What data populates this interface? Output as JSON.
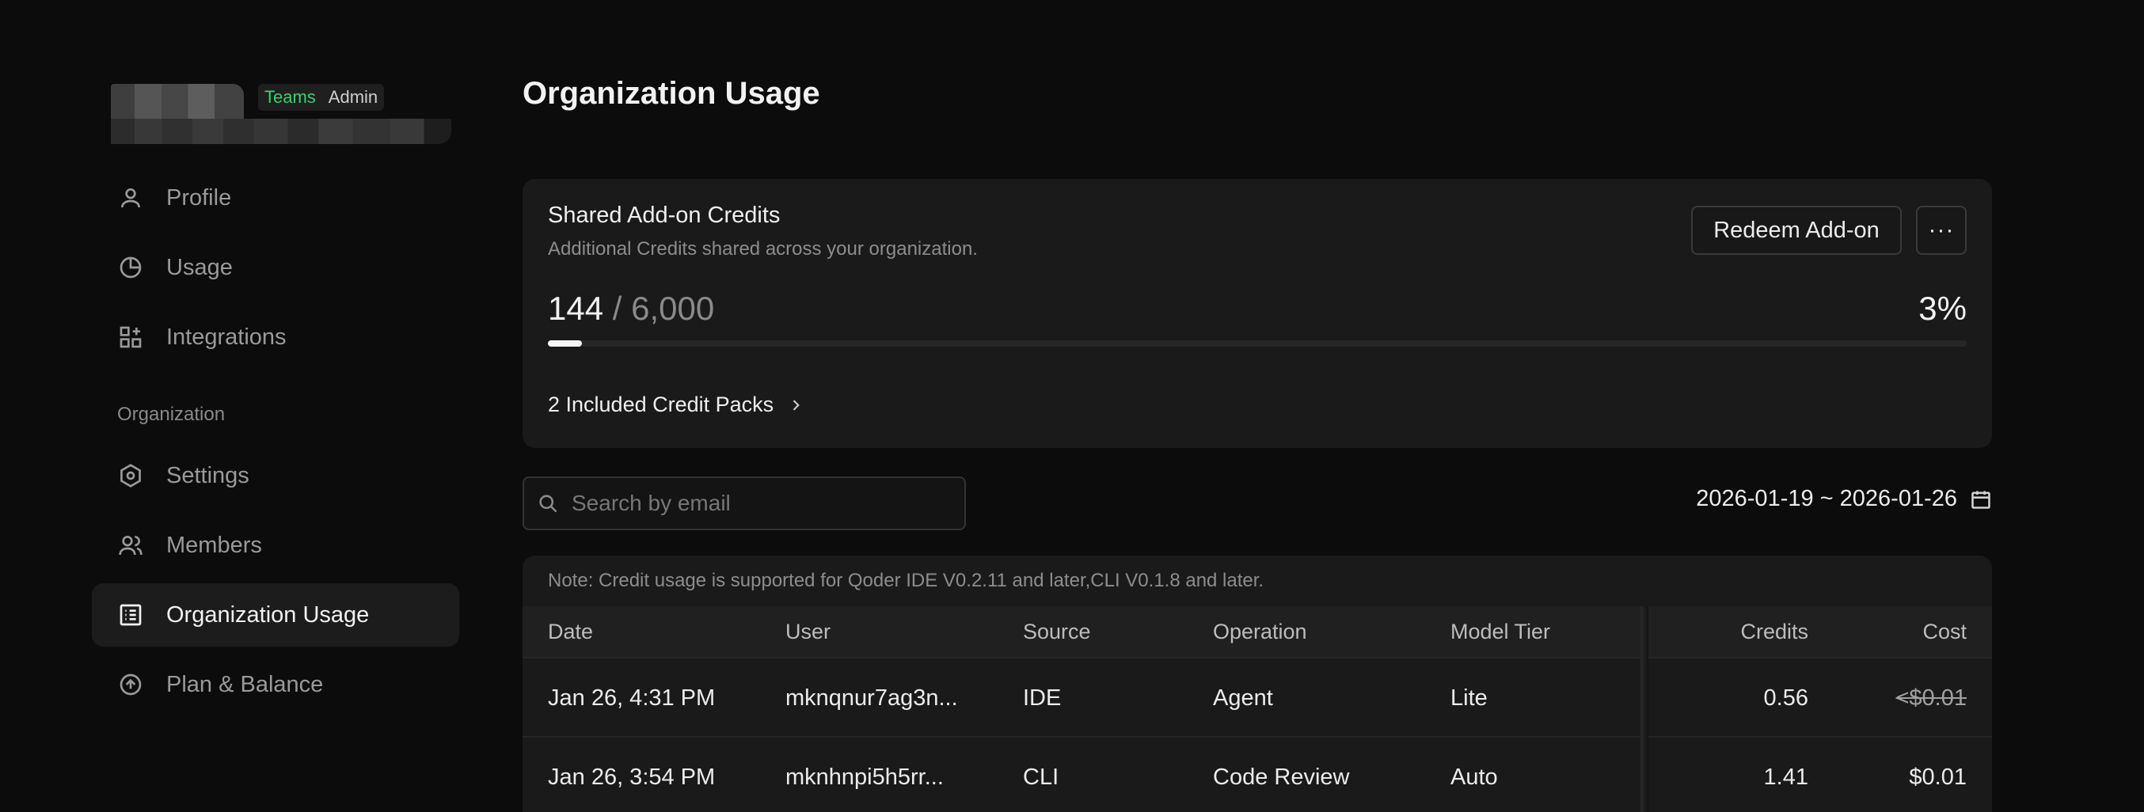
{
  "account": {
    "badge_plan": "Teams",
    "badge_role": "Admin"
  },
  "sidebar": {
    "items": [
      {
        "label": "Profile",
        "icon": "user-icon"
      },
      {
        "label": "Usage",
        "icon": "pie-chart-icon"
      },
      {
        "label": "Integrations",
        "icon": "integrations-icon"
      }
    ],
    "org_section_label": "Organization",
    "org_items": [
      {
        "label": "Settings",
        "icon": "hexagon-settings-icon"
      },
      {
        "label": "Members",
        "icon": "users-icon"
      },
      {
        "label": "Organization Usage",
        "icon": "list-icon",
        "active": true
      },
      {
        "label": "Plan & Balance",
        "icon": "arrow-up-circle-icon"
      }
    ]
  },
  "page": {
    "title": "Organization Usage"
  },
  "credits_card": {
    "title": "Shared Add-on Credits",
    "subtitle": "Additional Credits shared across your organization.",
    "redeem_label": "Redeem Add-on",
    "more_label": "···",
    "used": "144",
    "separator": " / ",
    "total": "6,000",
    "percent": "3%",
    "progress_fraction": 0.024,
    "packs_label": "2 Included Credit Packs"
  },
  "filters": {
    "search_placeholder": "Search by email",
    "date_range": "2026-01-19 ~ 2026-01-26"
  },
  "table": {
    "note": "Note: Credit usage is supported for Qoder IDE V0.2.11 and later,CLI V0.1.8 and later.",
    "headers": {
      "date": "Date",
      "user": "User",
      "source": "Source",
      "operation": "Operation",
      "model_tier": "Model Tier",
      "hidden": "I",
      "credits": "Credits",
      "cost": "Cost"
    },
    "rows": [
      {
        "date": "Jan 26, 4:31 PM",
        "user": "mknqnur7ag3n...",
        "source": "IDE",
        "operation": "Agent",
        "model_tier": "Lite",
        "hidden": "I",
        "credits": "0.56",
        "cost": "<$0.01"
      },
      {
        "date": "Jan 26, 3:54 PM",
        "user": "mknhnpi5h5rr...",
        "source": "CLI",
        "operation": "Code Review",
        "model_tier": "Auto",
        "hidden": "(",
        "credits": "1.41",
        "cost": "$0.01"
      }
    ]
  },
  "colors": {
    "background": "#0c0c0c",
    "card": "#1a1a1a",
    "accent_green": "#3ccf6e"
  }
}
